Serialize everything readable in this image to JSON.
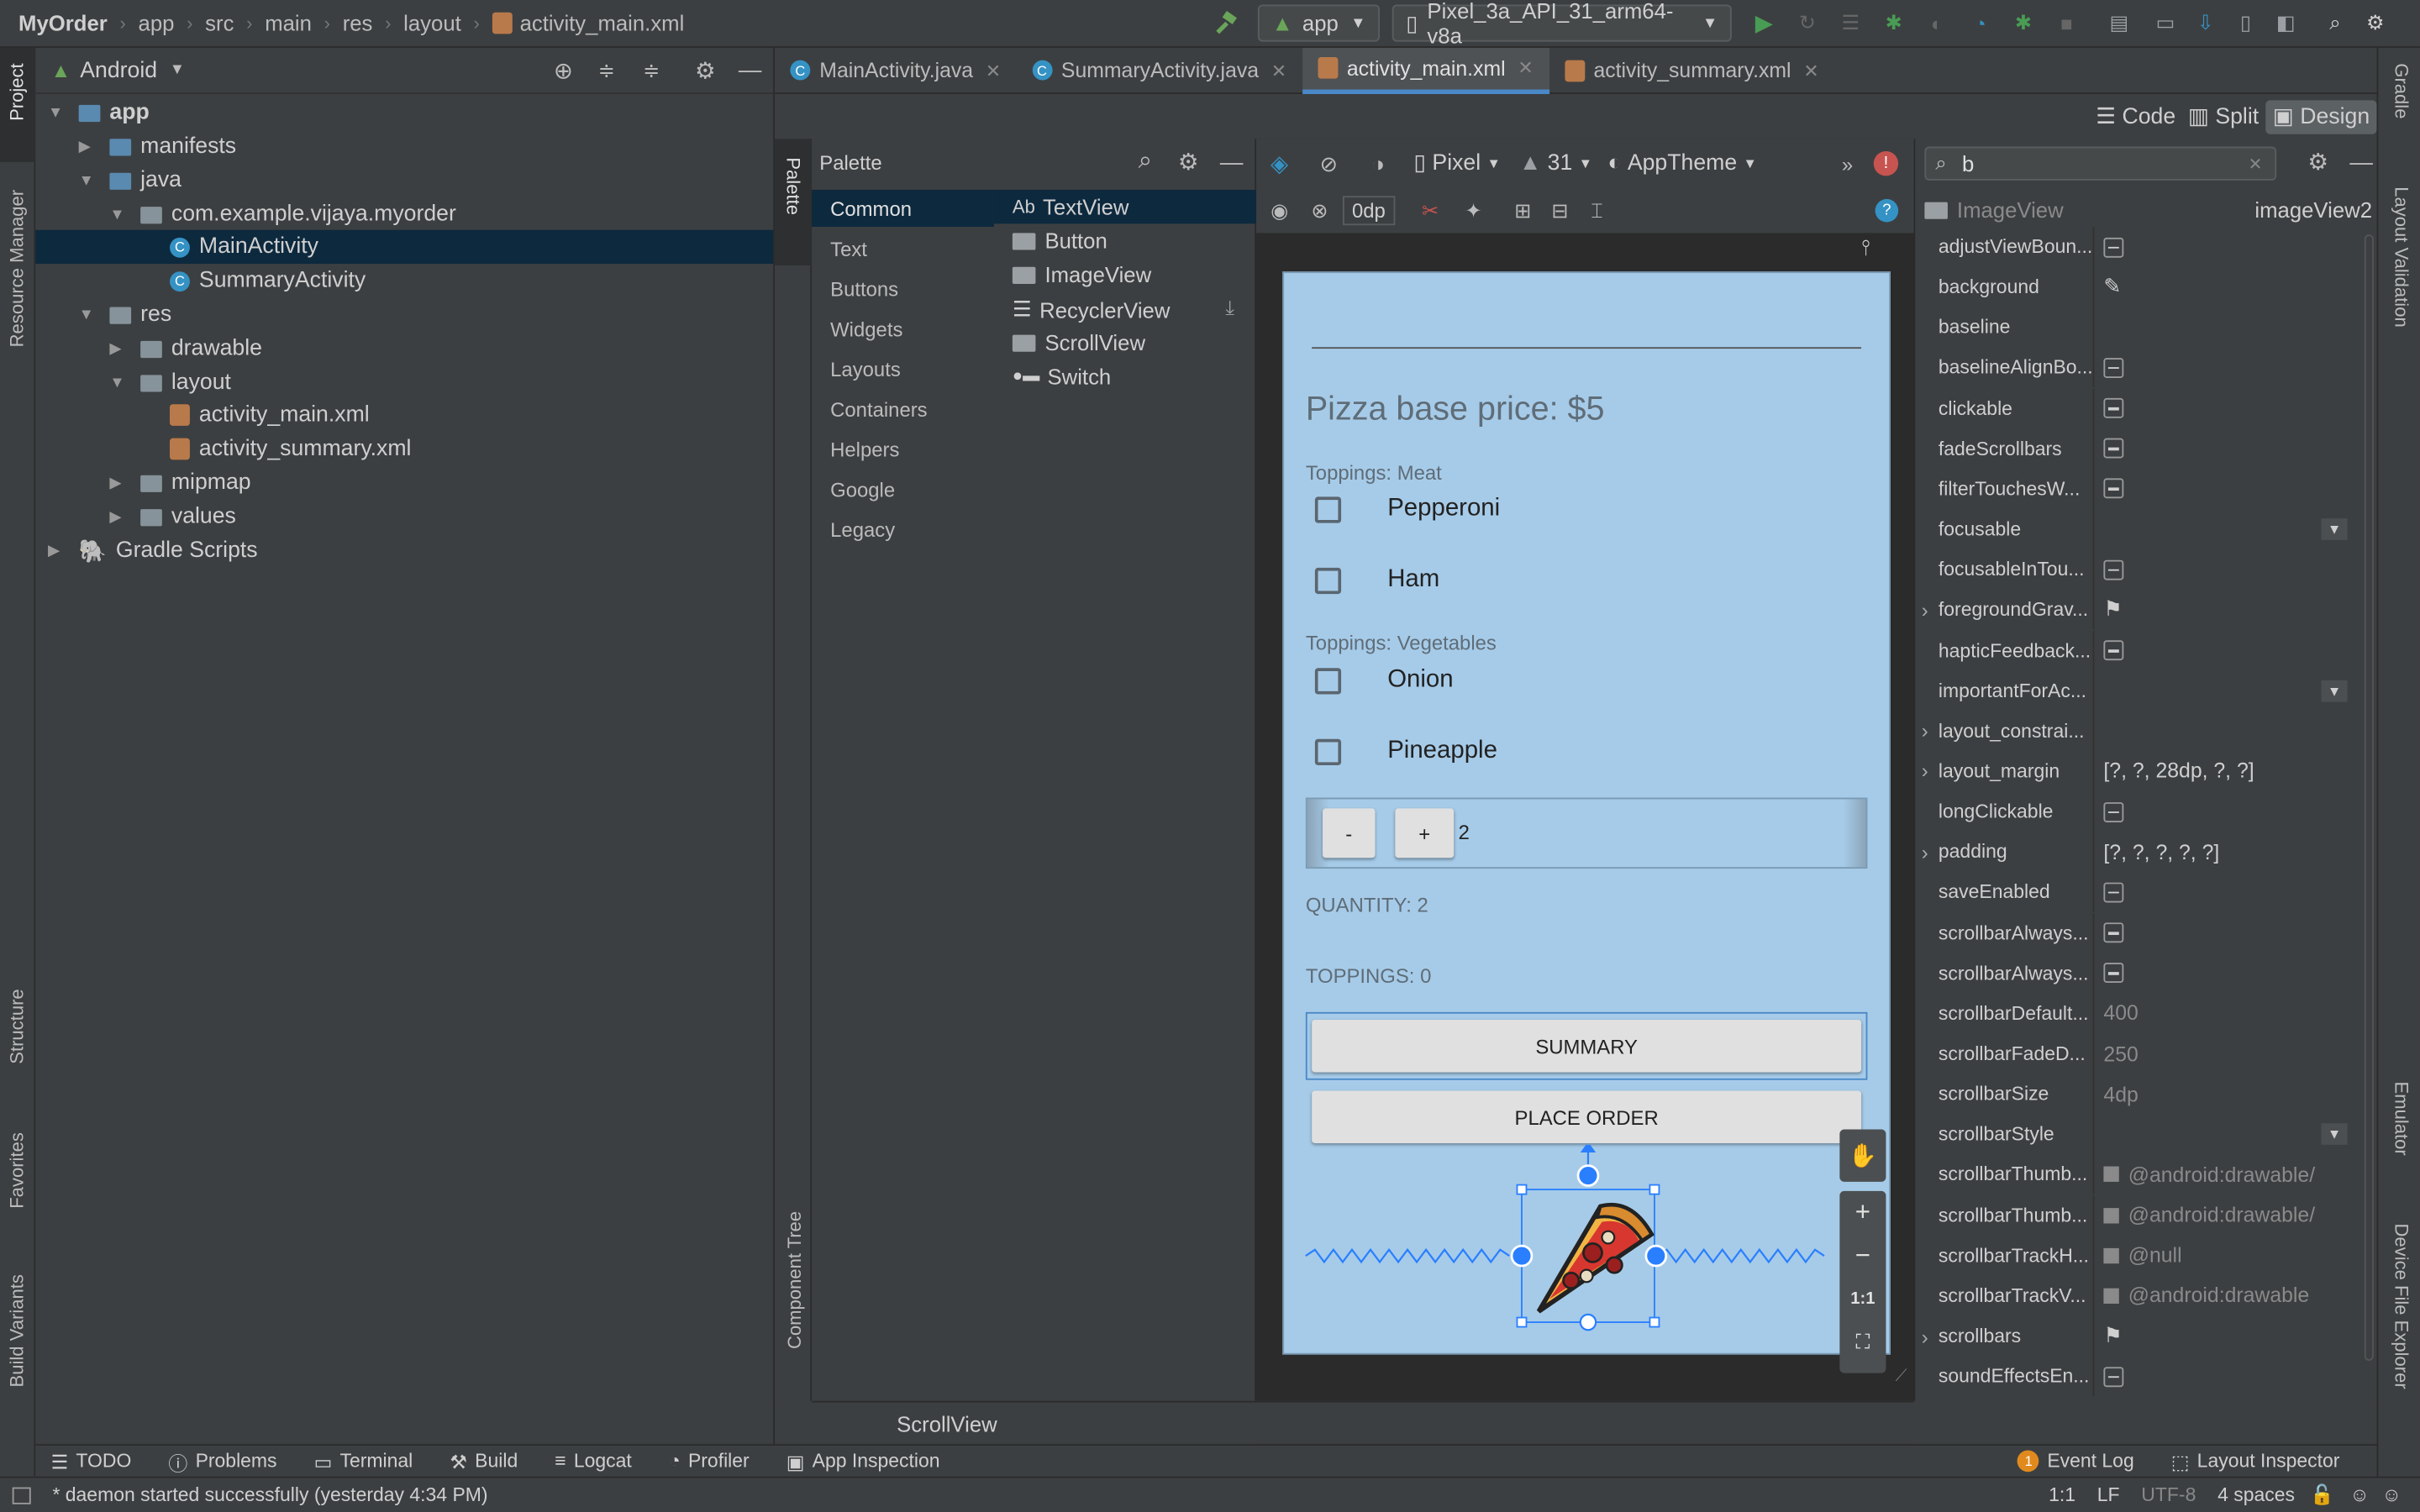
{
  "breadcrumbs": [
    "MyOrder",
    "app",
    "src",
    "main",
    "res",
    "layout",
    "activity_main.xml"
  ],
  "run_config": {
    "module": "app",
    "device": "Pixel_3a_API_31_arm64-v8a"
  },
  "left_stripe": {
    "project": "Project",
    "resource_manager": "Resource Manager",
    "structure": "Structure",
    "favorites": "Favorites",
    "build_variants": "Build Variants"
  },
  "project_panel": {
    "view_mode": "Android"
  },
  "tree": [
    "app",
    "manifests",
    "java",
    "com.example.vijaya.myorder",
    "MainActivity",
    "SummaryActivity",
    "res",
    "drawable",
    "layout",
    "activity_main.xml",
    "activity_summary.xml",
    "mipmap",
    "values",
    "Gradle Scripts"
  ],
  "tabs": [
    "MainActivity.java",
    "SummaryActivity.java",
    "activity_main.xml",
    "activity_summary.xml"
  ],
  "view_modes": {
    "code": "Code",
    "split": "Split",
    "design": "Design"
  },
  "palette": {
    "stripe_label": "Palette",
    "component_tree": "Component Tree",
    "title": "Palette",
    "categories": [
      "Common",
      "Text",
      "Buttons",
      "Widgets",
      "Layouts",
      "Containers",
      "Helpers",
      "Google",
      "Legacy"
    ],
    "items": [
      "TextView",
      "Button",
      "ImageView",
      "RecyclerView",
      "ScrollView",
      "Switch"
    ],
    "textview_prefix": "Ab"
  },
  "design_toolbar": {
    "device": "Pixel",
    "api": "31",
    "theme": "AppTheme",
    "margin": "0dp"
  },
  "phone": {
    "price": "Pizza base price: $5",
    "meat_header": "Toppings: Meat",
    "pepperoni": "Pepperoni",
    "ham": "Ham",
    "veg_header": "Toppings: Vegetables",
    "onion": "Onion",
    "pineapple": "Pineapple",
    "minus": "-",
    "plus": "+",
    "qty_value": "2",
    "quantity": "QUANTITY: 2",
    "toppings": "TOPPINGS: 0",
    "summary": "SUMMARY",
    "place_order": "PLACE ORDER"
  },
  "zoom": {
    "fit": "1:1"
  },
  "selected_component": "ScrollView",
  "attributes": {
    "search": "b",
    "component": "ImageView",
    "id": "imageView2",
    "rows": [
      {
        "name": "adjustViewBoun...",
        "type": "minus"
      },
      {
        "name": "background",
        "type": "picker"
      },
      {
        "name": "baseline",
        "type": "text",
        "value": ""
      },
      {
        "name": "baselineAlignBo...",
        "type": "minus"
      },
      {
        "name": "clickable",
        "type": "minus"
      },
      {
        "name": "fadeScrollbars",
        "type": "minus"
      },
      {
        "name": "filterTouchesW...",
        "type": "minus"
      },
      {
        "name": "focusable",
        "type": "dropdown"
      },
      {
        "name": "focusableInTou...",
        "type": "minus"
      },
      {
        "name": "foregroundGrav...",
        "type": "flag",
        "expand": true
      },
      {
        "name": "hapticFeedback...",
        "type": "minus"
      },
      {
        "name": "importantForAc...",
        "type": "dropdown"
      },
      {
        "name": "layout_constrai...",
        "type": "text",
        "value": "",
        "expand": true
      },
      {
        "name": "layout_margin",
        "type": "text",
        "value": "[?, ?, 28dp, ?, ?]",
        "expand": true
      },
      {
        "name": "longClickable",
        "type": "minus"
      },
      {
        "name": "padding",
        "type": "text",
        "value": "[?, ?, ?, ?, ?]",
        "expand": true
      },
      {
        "name": "saveEnabled",
        "type": "minus"
      },
      {
        "name": "scrollbarAlways...",
        "type": "minus"
      },
      {
        "name": "scrollbarAlways...",
        "type": "minus"
      },
      {
        "name": "scrollbarDefault...",
        "type": "dim",
        "value": "400"
      },
      {
        "name": "scrollbarFadeD...",
        "type": "dim",
        "value": "250"
      },
      {
        "name": "scrollbarSize",
        "type": "dim",
        "value": "4dp"
      },
      {
        "name": "scrollbarStyle",
        "type": "dropdown"
      },
      {
        "name": "scrollbarThumb...",
        "type": "dim",
        "value": "@android:drawable/"
      },
      {
        "name": "scrollbarThumb...",
        "type": "dim",
        "value": "@android:drawable/"
      },
      {
        "name": "scrollbarTrackH...",
        "type": "dim",
        "value": "@null"
      },
      {
        "name": "scrollbarTrackV...",
        "type": "dim",
        "value": "@android:drawable"
      },
      {
        "name": "scrollbars",
        "type": "flag",
        "expand": true
      },
      {
        "name": "soundEffectsEn...",
        "type": "minus"
      }
    ]
  },
  "right_stripe": {
    "gradle": "Gradle",
    "layout_validation": "Layout Validation",
    "emulator": "Emulator",
    "device_file_explorer": "Device File Explorer"
  },
  "tool_windows": [
    "TODO",
    "Problems",
    "Terminal",
    "Build",
    "Logcat",
    "Profiler",
    "App Inspection"
  ],
  "tool_windows_right": [
    "Event Log",
    "Layout Inspector"
  ],
  "event_count": "1",
  "status": {
    "message": "* daemon started successfully (yesterday 4:34 PM)",
    "position": "1:1",
    "line_sep": "LF",
    "encoding": "UTF-8",
    "indent": "4 spaces"
  },
  "colors": {
    "accent": "#4a88c7",
    "selection": "#0d293e",
    "phone_bg": "#a6cbe8",
    "run_green": "#499c54"
  }
}
